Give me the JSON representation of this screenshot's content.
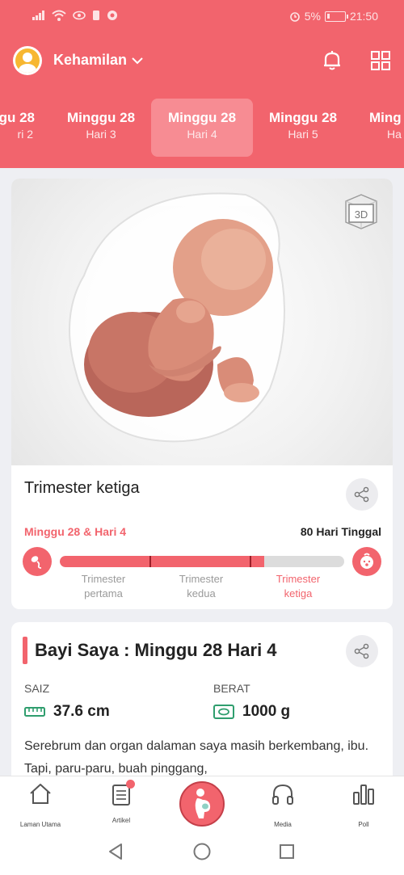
{
  "status_bar": {
    "battery": "5%",
    "time": "21:50"
  },
  "app_bar": {
    "title": "Kehamilan"
  },
  "week_tabs": [
    {
      "week": "gu 28",
      "day": "ri 2"
    },
    {
      "week": "Minggu 28",
      "day": "Hari 3"
    },
    {
      "week": "Minggu 28",
      "day": "Hari 4"
    },
    {
      "week": "Minggu 28",
      "day": "Hari 5"
    },
    {
      "week": "Ming",
      "day": "Ha"
    }
  ],
  "trimester_card": {
    "badge": "3D",
    "title": "Trimester ketiga",
    "progress_label": "Minggu 28 & Hari 4",
    "remaining": "80 Hari Tinggal",
    "progress_fraction": 0.72,
    "trimesters": [
      {
        "line1": "Trimester",
        "line2": "pertama"
      },
      {
        "line1": "Trimester",
        "line2": "kedua"
      },
      {
        "line1": "Trimester",
        "line2": "ketiga"
      }
    ],
    "active_trimester": 3
  },
  "baby_card": {
    "title": "Bayi Saya : Minggu 28 Hari 4",
    "size_label": "SAIZ",
    "size_value": "37.6 cm",
    "weight_label": "BERAT",
    "weight_value": "1000 g",
    "description": "Serebrum dan organ dalaman saya masih berkembang, ibu. Tapi, paru-paru, buah pinggang,"
  },
  "bottom_nav": {
    "home": "Laman Utama",
    "articles": "Artikel",
    "media": "Media",
    "poll": "Poll"
  },
  "colors": {
    "accent": "#f2646d",
    "tab_active": "#f78c93"
  }
}
